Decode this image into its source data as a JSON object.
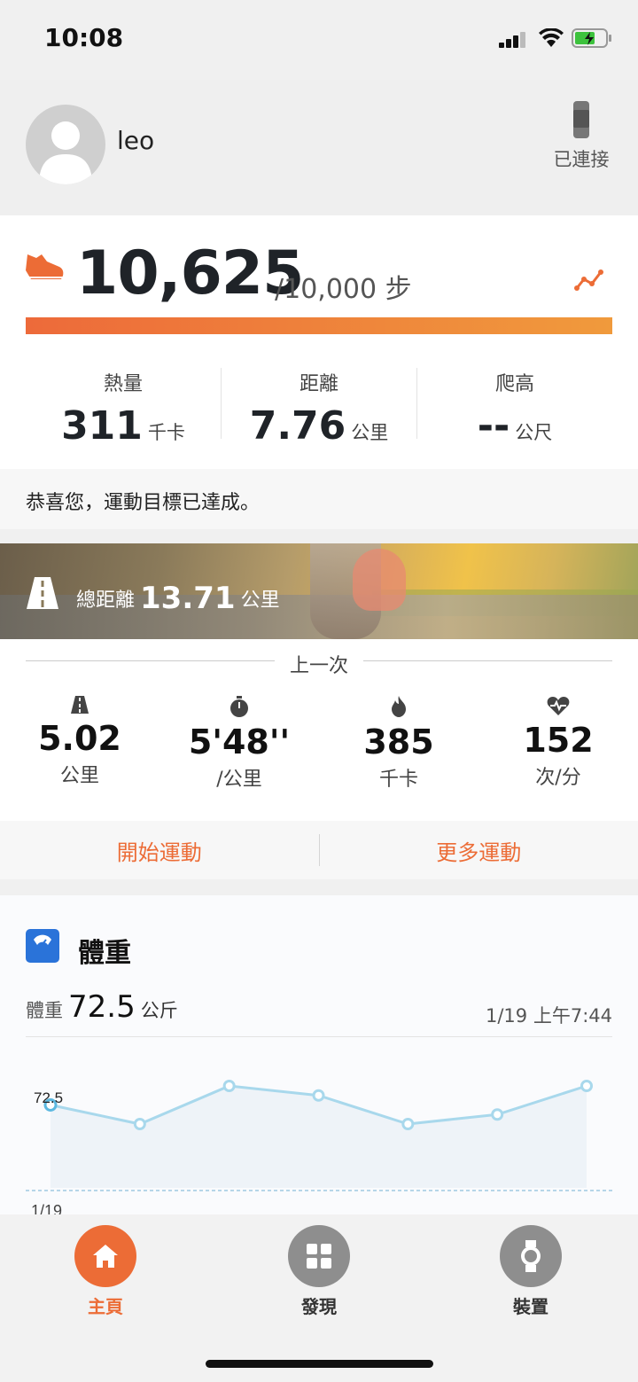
{
  "status_bar": {
    "time": "10:08"
  },
  "profile": {
    "username": "leo",
    "device_status": "已連接"
  },
  "steps": {
    "value": "10,625",
    "goal_text": "/10,000 步",
    "progress": 1.0,
    "stats": [
      {
        "label": "熱量",
        "value": "311",
        "unit": "千卡"
      },
      {
        "label": "距離",
        "value": "7.76",
        "unit": "公里"
      },
      {
        "label": "爬高",
        "value": "--",
        "unit": "公尺"
      }
    ],
    "congrats": "恭喜您，運動目標已達成。"
  },
  "banner": {
    "label": "總距離",
    "value": "13.71",
    "unit": "公里"
  },
  "last_workout": {
    "title": "上一次",
    "stats": [
      {
        "icon": "road-icon",
        "value": "5.02",
        "unit": "公里"
      },
      {
        "icon": "stopwatch-icon",
        "value": "5'48''",
        "unit": "/公里"
      },
      {
        "icon": "flame-icon",
        "value": "385",
        "unit": "千卡"
      },
      {
        "icon": "heart-rate-icon",
        "value": "152",
        "unit": "次/分"
      }
    ]
  },
  "actions": {
    "start": "開始運動",
    "more": "更多運動"
  },
  "weight": {
    "title": "體重",
    "label": "體重",
    "value": "72.5",
    "unit": "公斤",
    "date": "1/19 上午7:44",
    "chart_point_label": "72.5",
    "chart_x_label": "1/19"
  },
  "chart_data": {
    "type": "line",
    "series": [
      {
        "values": [
          72.5,
          71.5,
          73.5,
          73.0,
          71.5,
          72.0,
          73.5
        ]
      }
    ],
    "point_labels": [
      "72.5"
    ],
    "x_labels": [
      "1/19"
    ]
  },
  "nav": {
    "home": "主頁",
    "discover": "發現",
    "device": "裝置"
  },
  "colors": {
    "accent": "#ec6c36",
    "chart_line": "#a8d8ec"
  }
}
